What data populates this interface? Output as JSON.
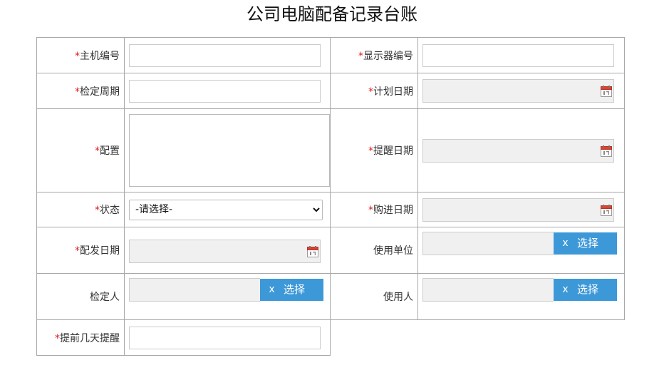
{
  "title": "公司电脑配备记录台账",
  "required_mark": "*",
  "fields": {
    "host_no": {
      "label": "主机编号",
      "value": ""
    },
    "monitor_no": {
      "label": "显示器编号",
      "value": ""
    },
    "calib_cycle": {
      "label": "检定周期",
      "value": ""
    },
    "plan_date": {
      "label": "计划日期",
      "value": ""
    },
    "config": {
      "label": "配置",
      "value": ""
    },
    "remind_date": {
      "label": "提醒日期",
      "value": ""
    },
    "status": {
      "label": "状态",
      "selected": "-请选择-"
    },
    "purchase_date": {
      "label": "购进日期",
      "value": ""
    },
    "issue_date": {
      "label": "配发日期",
      "value": ""
    },
    "use_unit": {
      "label": "使用单位",
      "value": ""
    },
    "inspector": {
      "label": "检定人",
      "value": ""
    },
    "user": {
      "label": "使用人",
      "value": ""
    },
    "remind_days": {
      "label": "提前几天提醒",
      "value": ""
    }
  },
  "buttons": {
    "clear": "x",
    "choose": "选择"
  },
  "icons": {
    "calendar": "calendar-icon"
  },
  "colors": {
    "required": "#e02020",
    "button": "#3d98d8",
    "readonly_bg": "#f0f0f0",
    "border": "#a8a8a8"
  }
}
